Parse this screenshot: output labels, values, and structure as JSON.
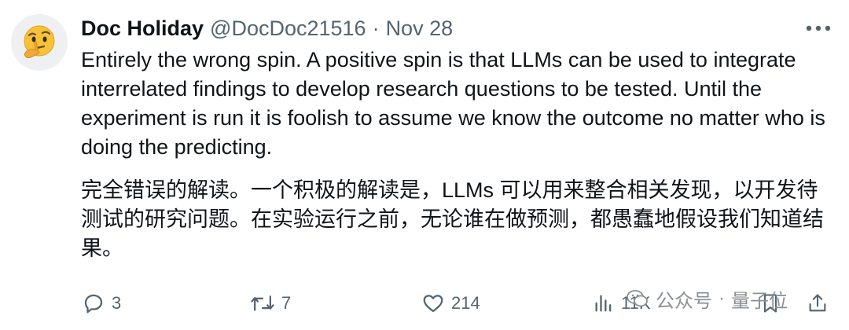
{
  "tweet": {
    "author_name": "Doc Holiday",
    "handle": "@DocDoc21516",
    "separator": "·",
    "date": "Nov 28",
    "avatar_icon": "thinking-face-emoji",
    "text_en": "Entirely the wrong spin. A positive spin is that LLMs can be used to integrate interrelated findings to develop research questions to be tested. Until the experiment is run it is foolish to assume we know the outcome no matter who is doing the predicting.",
    "text_cn": "完全错误的解读。一个积极的解读是，LLMs 可以用来整合相关发现，以开发待测试的研究问题。在实验运行之前，无论谁在做预测，都愚蠢地假设我们知道结果。"
  },
  "actions": {
    "replies": "3",
    "retweets": "7",
    "likes": "214",
    "views": "11K"
  },
  "watermark": {
    "channel": "公众号",
    "separator": "·",
    "name": "量子位"
  },
  "colors": {
    "text": "#0f1419",
    "secondary": "#536471",
    "avatar_bg": "#eef0f2",
    "watermark": "#8a8f94"
  }
}
